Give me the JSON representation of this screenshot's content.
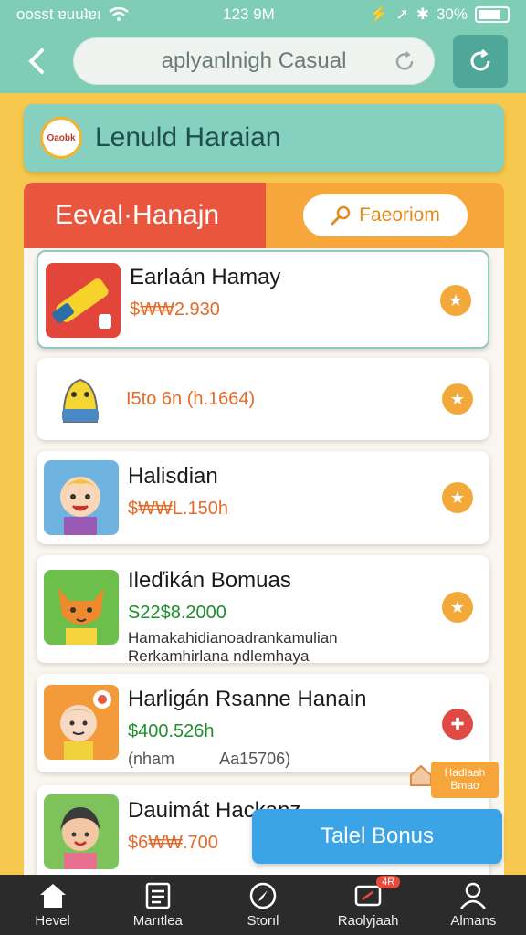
{
  "status_bar": {
    "carrier": "oosst ɐuuʇɐı",
    "time": "123 9M",
    "battery": "30%",
    "colors": {
      "bg": "#7fcdb5"
    }
  },
  "header": {
    "search_text": "aplyanlnigh Casual",
    "back_icon": "chevron-left-icon",
    "refresh_icon": "refresh-icon"
  },
  "title_card": {
    "logo_text": "Oaobk",
    "title": "Lenuld Haraian"
  },
  "panel": {
    "tab_left": "Eeval·Hanajn",
    "fav_button": "Faeoriom"
  },
  "items": [
    {
      "name": "Earlaán Hamay",
      "price": "$₩₩2.930",
      "price_color": "orange",
      "action": "star-icon"
    },
    {
      "name": "",
      "price": "I5to 6n (h.1664)",
      "price_color": "orange",
      "action": "star-icon"
    },
    {
      "name": "Halisdian",
      "price": "$₩₩L.150h",
      "price_color": "orange",
      "action": "star-icon"
    },
    {
      "name": "Ileďikán Bomuas",
      "price": "S22$8.2000",
      "price_color": "green",
      "desc_1": "Hamakahidianoadrankamulian",
      "desc_2": "Rerkamhirlana ndlemhaya",
      "action": "star-icon"
    },
    {
      "name": "Harligán Rsanne Hanain",
      "price": "$400.526h",
      "price_color": "green",
      "meta_left": "(nham",
      "meta_right": "Aa15706)",
      "action": "plus-icon"
    },
    {
      "name": "Dauimát Hackanz",
      "price": "$6₩₩.700",
      "price_color": "orange",
      "action": "star-icon"
    }
  ],
  "floating": {
    "bonus_button": "Talel Bonus",
    "mini_badge_line1": "Hadlaah",
    "mini_badge_line2": "Bmao"
  },
  "bottom_nav": [
    {
      "label": "Hevel",
      "icon": "home-icon"
    },
    {
      "label": "Marıtlea",
      "icon": "list-icon"
    },
    {
      "label": "Storıl",
      "icon": "compass-icon"
    },
    {
      "label": "Raolyjaah",
      "icon": "card-icon",
      "badge": "4R"
    },
    {
      "label": "Almans",
      "icon": "user-icon"
    }
  ]
}
